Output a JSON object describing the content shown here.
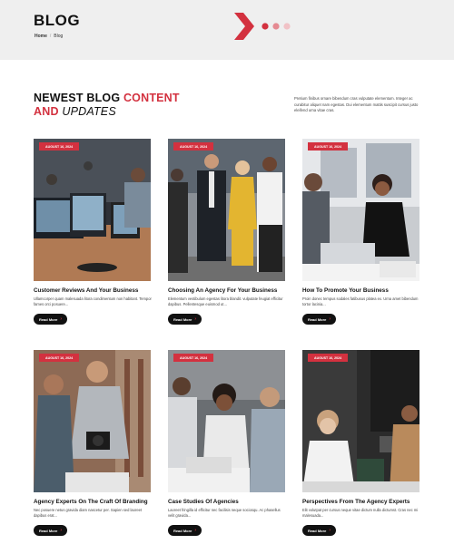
{
  "hero": {
    "title": "BLOG",
    "breadcrumb": {
      "home": "Home",
      "separator": "/",
      "current": "Blog"
    }
  },
  "section": {
    "heading_part1": "NEWEST BLOG ",
    "heading_red1": "CONTENT",
    "heading_red2": "AND",
    "heading_italic": " UPDATES",
    "intro": "Pretium finibus ornare bibendum cras vulputate elementum. Integer ac curabitur aliquet nam egestas. Dui elementum mattis suscipit cursus justo eleifend urna vitae cras."
  },
  "colors": {
    "accent": "#d3313f",
    "dark": "#111111",
    "hero_bg": "#efefef"
  },
  "posts": [
    {
      "date": "AUGUST 16, 2024",
      "title": "Customer Reviews And Your Business",
      "excerpt": "Ullamcorper quam malesuada litora condimentum non habitant. Tempor fames orci posuere...",
      "button": "Read More"
    },
    {
      "date": "AUGUST 16, 2024",
      "title": "Choosing An Agency For Your Business",
      "excerpt": "Elementum vestibulum egestas litora blandit. vulputate feugiat efficitur dapibus. Pellentesque euismod ut...",
      "button": "Read More"
    },
    {
      "date": "AUGUST 16, 2024",
      "title": "How To Promote Your Business",
      "excerpt": "Proin donec tempus sodales fatibusus platea ex. Urna amet bibendum tortor lacinia...",
      "button": "Read More"
    },
    {
      "date": "AUGUST 16, 2024",
      "title": "Agency Experts On The Craft Of Branding",
      "excerpt": "Nec posuere netus gravida diam nascetur per. Sapien sed laoreet dapibus erat...",
      "button": "Read More"
    },
    {
      "date": "AUGUST 16, 2024",
      "title": "Case Studies Of Agencies",
      "excerpt": "Laoreet fringilla id efficitur nec facilisis neque sociosqu. Ac phasellus velit gravida...",
      "button": "Read More"
    },
    {
      "date": "AUGUST 16, 2024",
      "title": "Perspectives From The Agency Experts",
      "excerpt": "Elit volutpat per cursus neque vitae dictum nulla dictumst. Cras nec mi malesuada...",
      "button": "Read More"
    }
  ]
}
